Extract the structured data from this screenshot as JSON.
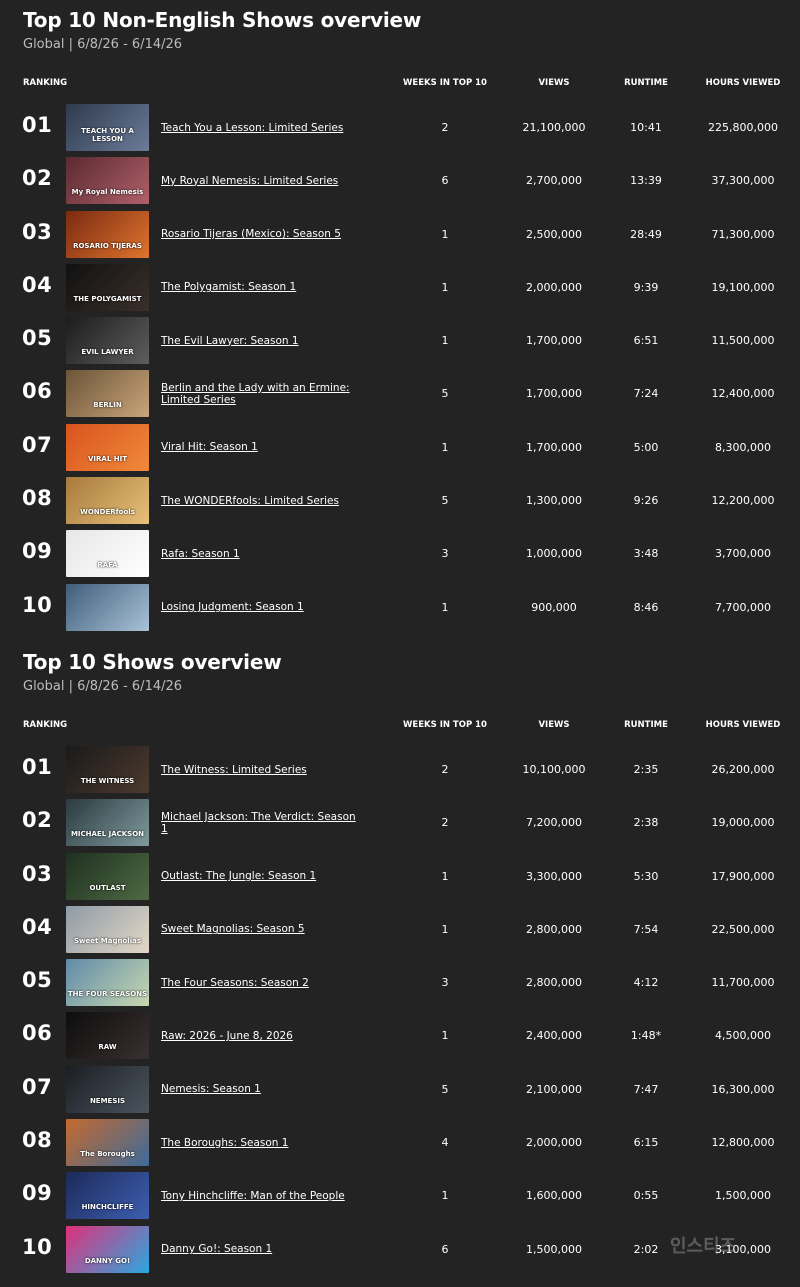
{
  "sections": [
    {
      "title": "Top 10 Non-English Shows overview",
      "subtitle": "Global | 6/8/26 - 6/14/26",
      "columns": {
        "ranking": "RANKING",
        "weeks": "WEEKS IN TOP 10",
        "views": "VIEWS",
        "runtime": "RUNTIME",
        "hours": "HOURS VIEWED"
      },
      "rows": [
        {
          "rank": "01",
          "title": "Teach You a Lesson: Limited Series",
          "weeks": "2",
          "views": "21,100,000",
          "runtime": "10:41",
          "hours": "225,800,000",
          "thumb_text": "TEACH YOU A LESSON",
          "thumb_colors": [
            "#2e3a4d",
            "#6b7c99"
          ]
        },
        {
          "rank": "02",
          "title": "My Royal Nemesis: Limited Series",
          "weeks": "6",
          "views": "2,700,000",
          "runtime": "13:39",
          "hours": "37,300,000",
          "thumb_text": "My Royal Nemesis",
          "thumb_colors": [
            "#5a2a2f",
            "#b0606a"
          ]
        },
        {
          "rank": "03",
          "title": "Rosario Tijeras (Mexico): Season 5",
          "weeks": "1",
          "views": "2,500,000",
          "runtime": "28:49",
          "hours": "71,300,000",
          "thumb_text": "ROSARIO TIJERAS",
          "thumb_colors": [
            "#7a2a10",
            "#e0742e"
          ]
        },
        {
          "rank": "04",
          "title": "The Polygamist: Season 1",
          "weeks": "1",
          "views": "2,000,000",
          "runtime": "9:39",
          "hours": "19,100,000",
          "thumb_text": "THE POLYGAMIST",
          "thumb_colors": [
            "#111111",
            "#3a2f2a"
          ]
        },
        {
          "rank": "05",
          "title": "The Evil Lawyer: Season 1",
          "weeks": "1",
          "views": "1,700,000",
          "runtime": "6:51",
          "hours": "11,500,000",
          "thumb_text": "EVIL LAWYER",
          "thumb_colors": [
            "#1c1c1c",
            "#5e5e5e"
          ]
        },
        {
          "rank": "06",
          "title": "Berlin and the Lady with an Ermine: Limited Series",
          "weeks": "5",
          "views": "1,700,000",
          "runtime": "7:24",
          "hours": "12,400,000",
          "thumb_text": "BERLIN",
          "thumb_colors": [
            "#6b5438",
            "#c9a57a"
          ]
        },
        {
          "rank": "07",
          "title": "Viral Hit: Season 1",
          "weeks": "1",
          "views": "1,700,000",
          "runtime": "5:00",
          "hours": "8,300,000",
          "thumb_text": "VIRAL HIT",
          "thumb_colors": [
            "#d9531e",
            "#f08a3a"
          ]
        },
        {
          "rank": "08",
          "title": "The WONDERfools: Limited Series",
          "weeks": "5",
          "views": "1,300,000",
          "runtime": "9:26",
          "hours": "12,200,000",
          "thumb_text": "WONDERfools",
          "thumb_colors": [
            "#a67a3c",
            "#e8c07a"
          ]
        },
        {
          "rank": "09",
          "title": "Rafa: Season 1",
          "weeks": "3",
          "views": "1,000,000",
          "runtime": "3:48",
          "hours": "3,700,000",
          "thumb_text": "RAFA",
          "thumb_colors": [
            "#e6e6e6",
            "#ffffff"
          ]
        },
        {
          "rank": "10",
          "title": "Losing Judgment: Season 1",
          "weeks": "1",
          "views": "900,000",
          "runtime": "8:46",
          "hours": "7,700,000",
          "thumb_text": "",
          "thumb_colors": [
            "#3f5d7a",
            "#a9c2d8"
          ]
        }
      ]
    },
    {
      "title": "Top 10 Shows overview",
      "subtitle": "Global | 6/8/26 - 6/14/26",
      "columns": {
        "ranking": "RANKING",
        "weeks": "WEEKS IN TOP 10",
        "views": "VIEWS",
        "runtime": "RUNTIME",
        "hours": "HOURS VIEWED"
      },
      "rows": [
        {
          "rank": "01",
          "title": "The Witness: Limited Series",
          "weeks": "2",
          "views": "10,100,000",
          "runtime": "2:35",
          "hours": "26,200,000",
          "thumb_text": "THE WITNESS",
          "thumb_colors": [
            "#1a1a1a",
            "#4d3a2e"
          ]
        },
        {
          "rank": "02",
          "title": "Michael Jackson: The Verdict: Season 1",
          "weeks": "2",
          "views": "7,200,000",
          "runtime": "2:38",
          "hours": "19,000,000",
          "thumb_text": "MICHAEL JACKSON",
          "thumb_colors": [
            "#2b3a3f",
            "#7f9a9e"
          ]
        },
        {
          "rank": "03",
          "title": "Outlast: The Jungle: Season 1",
          "weeks": "1",
          "views": "3,300,000",
          "runtime": "5:30",
          "hours": "17,900,000",
          "thumb_text": "OUTLAST",
          "thumb_colors": [
            "#1f3020",
            "#4e6a43"
          ]
        },
        {
          "rank": "04",
          "title": "Sweet Magnolias: Season 5",
          "weeks": "1",
          "views": "2,800,000",
          "runtime": "7:54",
          "hours": "22,500,000",
          "thumb_text": "Sweet Magnolias",
          "thumb_colors": [
            "#8d9aa6",
            "#e4d8c6"
          ]
        },
        {
          "rank": "05",
          "title": "The Four Seasons: Season 2",
          "weeks": "3",
          "views": "2,800,000",
          "runtime": "4:12",
          "hours": "11,700,000",
          "thumb_text": "THE FOUR SEASONS",
          "thumb_colors": [
            "#5f8aa8",
            "#c8d8b0"
          ]
        },
        {
          "rank": "06",
          "title": "Raw: 2026 - June 8, 2026",
          "weeks": "1",
          "views": "2,400,000",
          "runtime": "1:48*",
          "hours": "4,500,000",
          "thumb_text": "RAW",
          "thumb_colors": [
            "#0d0d0d",
            "#3a3030"
          ]
        },
        {
          "rank": "07",
          "title": "Nemesis: Season 1",
          "weeks": "5",
          "views": "2,100,000",
          "runtime": "7:47",
          "hours": "16,300,000",
          "thumb_text": "NEMESIS",
          "thumb_colors": [
            "#1b1f24",
            "#4b545e"
          ]
        },
        {
          "rank": "08",
          "title": "The Boroughs: Season 1",
          "weeks": "4",
          "views": "2,000,000",
          "runtime": "6:15",
          "hours": "12,800,000",
          "thumb_text": "The Boroughs",
          "thumb_colors": [
            "#c56a2e",
            "#3d6b9a"
          ]
        },
        {
          "rank": "09",
          "title": "Tony Hinchcliffe: Man of the People",
          "weeks": "1",
          "views": "1,600,000",
          "runtime": "0:55",
          "hours": "1,500,000",
          "thumb_text": "HINCHCLIFFE",
          "thumb_colors": [
            "#1c2a5a",
            "#3d5fb0"
          ]
        },
        {
          "rank": "10",
          "title": "Danny Go!: Season 1",
          "weeks": "6",
          "views": "1,500,000",
          "runtime": "2:02",
          "hours": "3,100,000",
          "thumb_text": "DANNY GO!",
          "thumb_colors": [
            "#e0307a",
            "#2aa8e0"
          ]
        }
      ]
    }
  ],
  "watermark": "인스티즈"
}
